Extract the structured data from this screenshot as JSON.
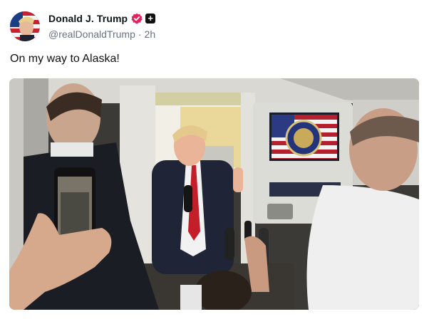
{
  "post": {
    "author": {
      "display_name": "Donald J. Trump",
      "handle": "@realDonaldTrump",
      "time": "2h",
      "separator": "·",
      "verified_color": "#e0245e"
    },
    "text": "On my way to Alaska!",
    "media": {
      "type": "photo",
      "icon": "photo-image"
    }
  },
  "badges": {
    "plus": "+"
  }
}
